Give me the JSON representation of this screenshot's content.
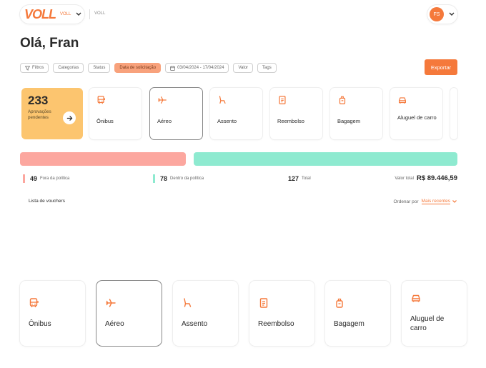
{
  "header": {
    "logo": "VOLL",
    "brand_small": "VOLL",
    "breadcrumb": "VOLL",
    "avatar_initials": "FS"
  },
  "greeting": "Olá, Fran",
  "filters": [
    {
      "label": "Filtros",
      "active": false
    },
    {
      "label": "Categorias",
      "active": false
    },
    {
      "label": "Status",
      "active": false
    },
    {
      "label": "Data de solicitação",
      "active": true
    },
    {
      "label": "03/04/2024 - 17/04/2024",
      "active": false
    },
    {
      "label": "Valor",
      "active": false
    },
    {
      "label": "Tags",
      "active": false
    }
  ],
  "export_label": "Exportar",
  "approvals": {
    "count": "233",
    "label": "Aprovações pendentes"
  },
  "categories": [
    {
      "label": "Ônibus",
      "icon": "bus-icon"
    },
    {
      "label": "Aéreo",
      "icon": "plane-icon",
      "selected": true
    },
    {
      "label": "Assento",
      "icon": "seat-icon"
    },
    {
      "label": "Reembolso",
      "icon": "receipt-icon"
    },
    {
      "label": "Bagagem",
      "icon": "luggage-icon"
    },
    {
      "label": "Aluguel de carro",
      "icon": "car-icon"
    }
  ],
  "policy": {
    "out_count": "49",
    "out_label": "Fora da política",
    "in_count": "78",
    "in_label": "Dentro da política",
    "total_count": "127",
    "total_label": "Total",
    "total_value_label": "Valor total",
    "total_value": "R$ 89.446,59",
    "out_share": 0.386
  },
  "list": {
    "title": "Lista de vouchers",
    "sort_label": "Ordenar por",
    "sort_value": "Mais recentes"
  },
  "colors": {
    "accent": "#f5793b",
    "approvals_bg": "#fcc56f",
    "out_policy": "#fca79f",
    "in_policy": "#8eead0"
  }
}
